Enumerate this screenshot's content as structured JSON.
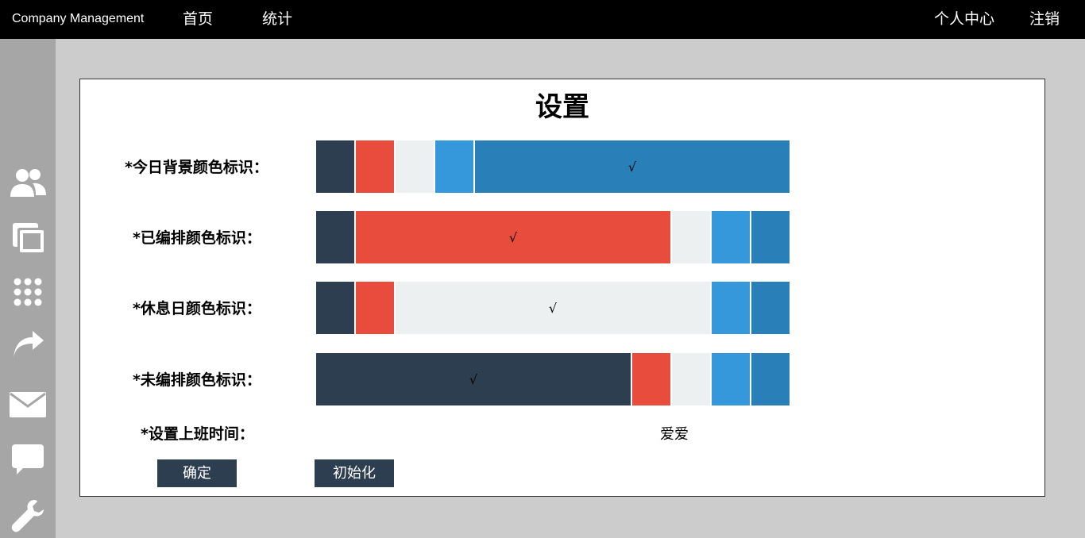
{
  "header": {
    "brand": "Company Management",
    "nav_left": [
      "首页",
      "统计"
    ],
    "nav_right": [
      "个人中心",
      "注销"
    ]
  },
  "sidebar": {
    "icons": [
      "users-icon",
      "windows-icon",
      "grid-icon",
      "share-icon",
      "mail-icon",
      "chat-icon",
      "wrench-icon"
    ]
  },
  "settings": {
    "title": "设置",
    "check_mark": "√",
    "palette": [
      "#2c3e50",
      "#e74c3c",
      "#ecf0f1",
      "#3498db",
      "#2980b9"
    ],
    "rows": [
      {
        "label": "*今日背景颜色标识：",
        "selected_index": 4
      },
      {
        "label": "*已编排颜色标识：",
        "selected_index": 1
      },
      {
        "label": "*休息日颜色标识：",
        "selected_index": 2
      },
      {
        "label": "*未编排颜色标识：",
        "selected_index": 0
      }
    ],
    "work_time_label": "*设置上班时间：",
    "work_time_value": "爱爱",
    "confirm_label": "确定",
    "reset_label": "初始化"
  }
}
